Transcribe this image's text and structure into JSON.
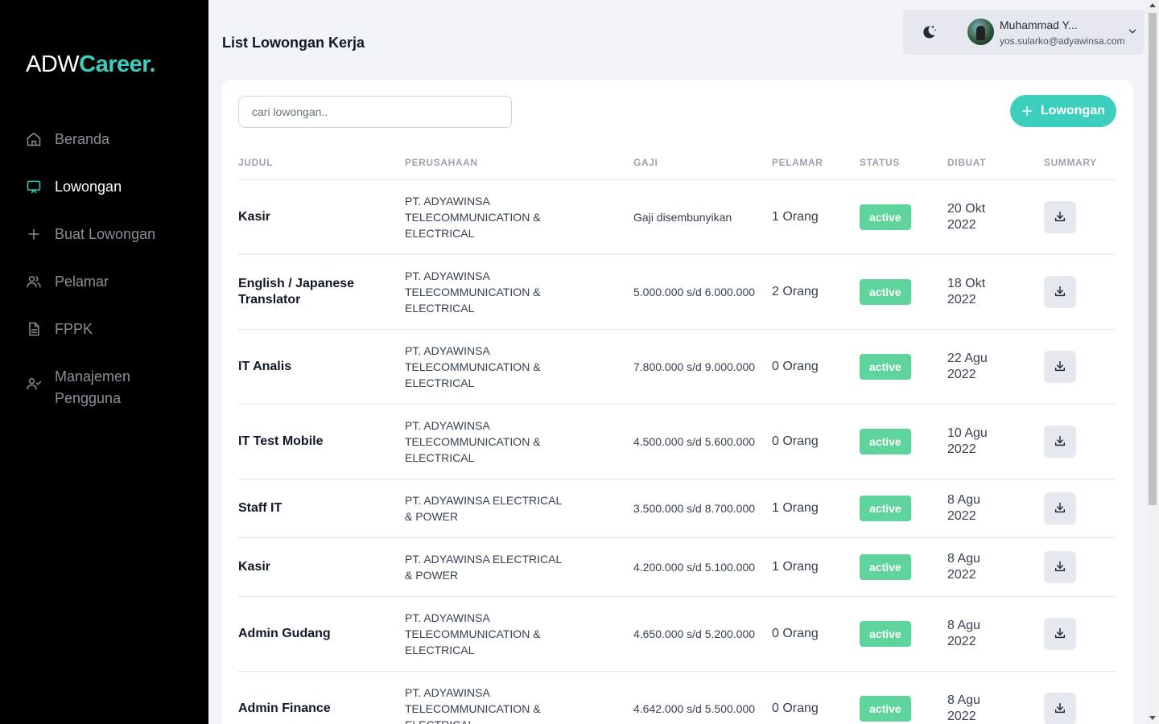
{
  "app": {
    "logo_prefix": "ADW",
    "logo_brand": "Career."
  },
  "sidebar": {
    "items": [
      {
        "label": "Beranda",
        "icon": "home-icon",
        "active": false
      },
      {
        "label": "Lowongan",
        "icon": "monitor-icon",
        "active": true
      },
      {
        "label": "Buat Lowongan",
        "icon": "plus-icon",
        "active": false
      },
      {
        "label": "Pelamar",
        "icon": "users-icon",
        "active": false
      },
      {
        "label": "FPPK",
        "icon": "document-icon",
        "active": false
      },
      {
        "label": "Manajemen Pengguna",
        "icon": "user-check-icon",
        "active": false
      }
    ]
  },
  "header": {
    "title": "List Lowongan Kerja",
    "theme_toggle_icon": "moon-icon",
    "user_name": "Muhammad Y...",
    "user_email": "yos.sularko@adyawinsa.com"
  },
  "toolbar": {
    "search_placeholder": "cari lowongan..",
    "search_value": "",
    "add_label": "Lowongan"
  },
  "table": {
    "columns": [
      "JUDUL",
      "PERUSAHAAN",
      "GAJI",
      "PELAMAR",
      "STATUS",
      "DIBUAT",
      "SUMMARY"
    ],
    "rows": [
      {
        "title": "Kasir",
        "company": "PT. ADYAWINSA TELECOMMUNICATION & ELECTRICAL",
        "salary": "Gaji disembunyikan",
        "applicants": "1 Orang",
        "status": "active",
        "created": "20 Okt 2022"
      },
      {
        "title": "English / Japanese Translator",
        "company": "PT. ADYAWINSA TELECOMMUNICATION & ELECTRICAL",
        "salary": "5.000.000 s/d 6.000.000",
        "applicants": "2 Orang",
        "status": "active",
        "created": "18 Okt 2022"
      },
      {
        "title": "IT Analis",
        "company": "PT. ADYAWINSA TELECOMMUNICATION & ELECTRICAL",
        "salary": "7.800.000 s/d 9.000.000",
        "applicants": "0 Orang",
        "status": "active",
        "created": "22 Agu 2022"
      },
      {
        "title": "IT Test Mobile",
        "company": "PT. ADYAWINSA TELECOMMUNICATION & ELECTRICAL",
        "salary": "4.500.000 s/d 5.600.000",
        "applicants": "0 Orang",
        "status": "active",
        "created": "10 Agu 2022"
      },
      {
        "title": "Staff IT",
        "company": "PT. ADYAWINSA ELECTRICAL & POWER",
        "salary": "3.500.000 s/d 8.700.000",
        "applicants": "1 Orang",
        "status": "active",
        "created": "8 Agu 2022"
      },
      {
        "title": "Kasir",
        "company": "PT. ADYAWINSA ELECTRICAL & POWER",
        "salary": "4.200.000 s/d 5.100.000",
        "applicants": "1 Orang",
        "status": "active",
        "created": "8 Agu 2022"
      },
      {
        "title": "Admin Gudang",
        "company": "PT. ADYAWINSA TELECOMMUNICATION & ELECTRICAL",
        "salary": "4.650.000 s/d 5.200.000",
        "applicants": "0 Orang",
        "status": "active",
        "created": "8 Agu 2022"
      },
      {
        "title": "Admin Finance",
        "company": "PT. ADYAWINSA TELECOMMUNICATION & ELECTRICAL",
        "salary": "4.642.000 s/d 5.500.000",
        "applicants": "0 Orang",
        "status": "active",
        "created": "8 Agu 2022"
      }
    ]
  },
  "colors": {
    "accent": "#3ccfbe",
    "status_active": "#5ed39b",
    "sidebar_bg": "#000000",
    "page_bg": "#f1f5f9"
  }
}
